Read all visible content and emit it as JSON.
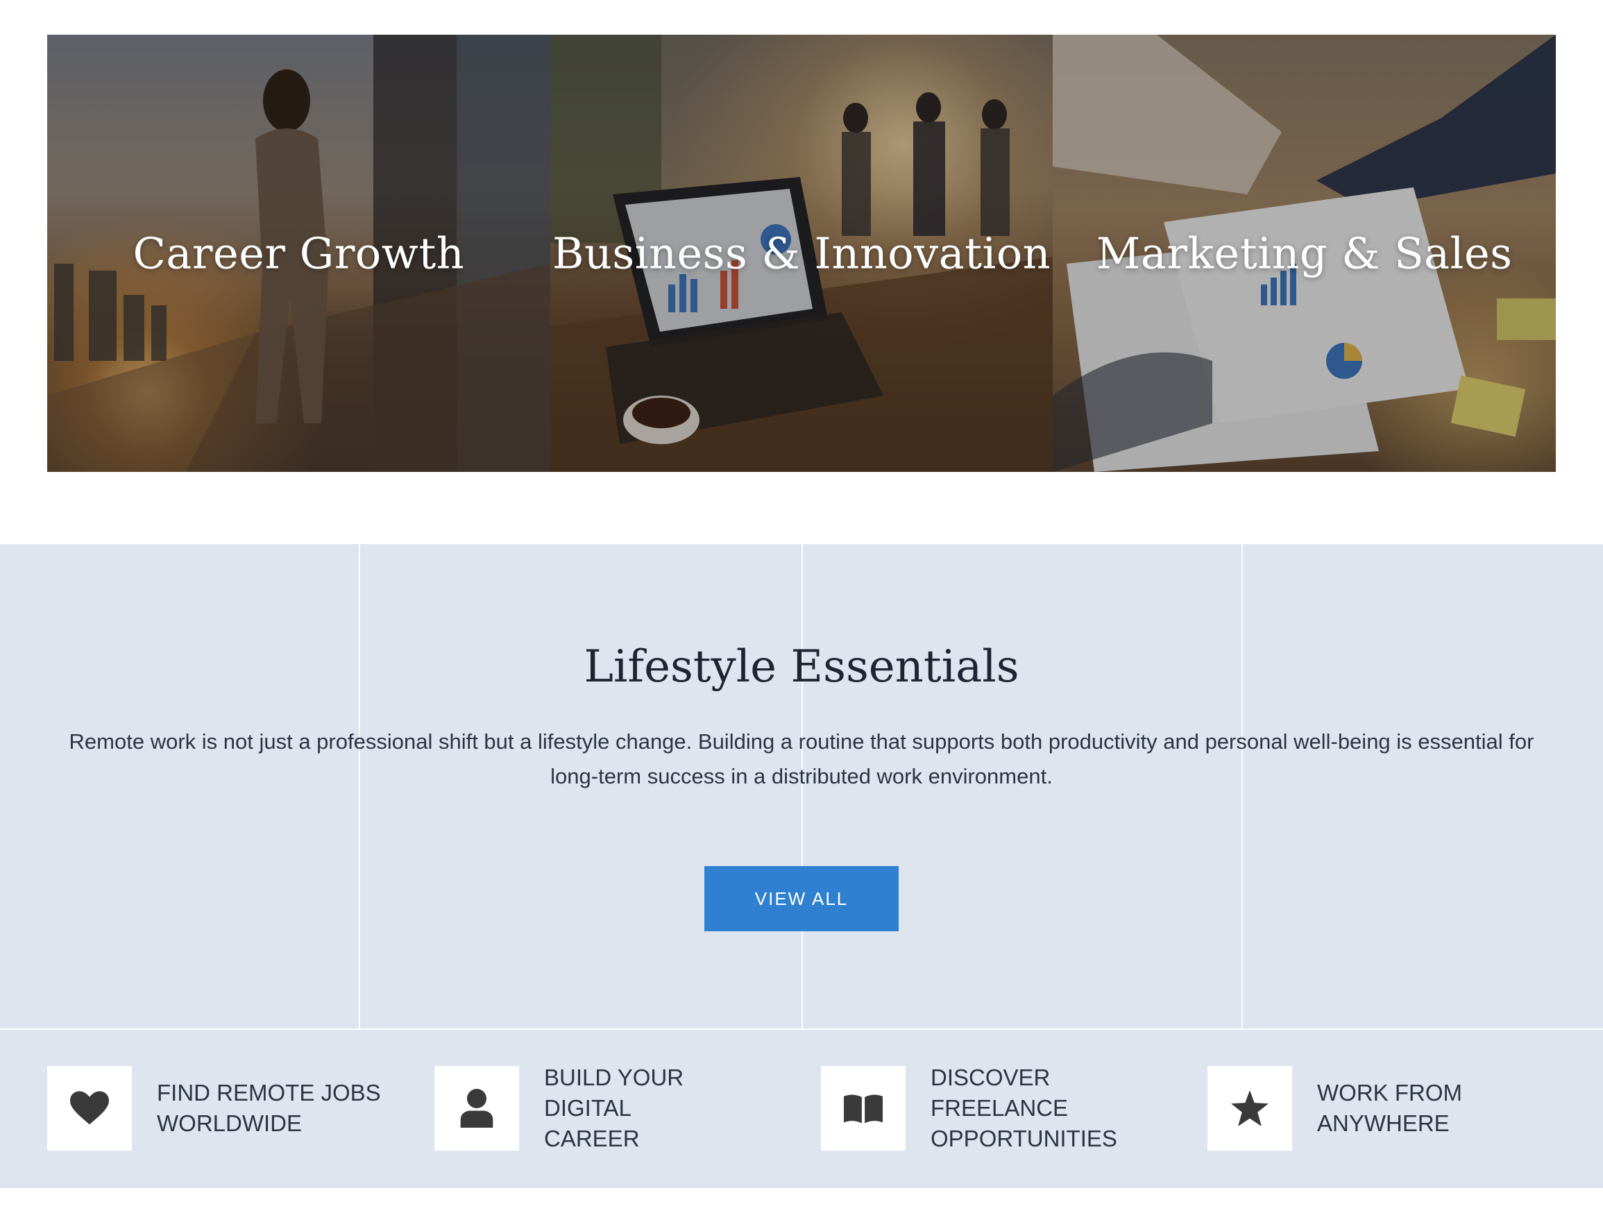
{
  "categories": [
    {
      "title": "Career Growth"
    },
    {
      "title": "Business & Innovation"
    },
    {
      "title": "Marketing & Sales"
    }
  ],
  "lifestyle": {
    "title": "Lifestyle Essentials",
    "text": "Remote work is not just a professional shift but a lifestyle change. Building a routine that supports both productivity and personal well-being is essential for long-term success in a distributed work environment.",
    "button_label": "VIEW ALL"
  },
  "features": [
    {
      "icon": "heart-icon",
      "line1": "FIND REMOTE JOBS",
      "line2": "WORLDWIDE"
    },
    {
      "icon": "user-icon",
      "line1": "BUILD YOUR DIGITAL",
      "line2": "CAREER"
    },
    {
      "icon": "book-icon",
      "line1": "DISCOVER FREELANCE",
      "line2": "OPPORTUNITIES"
    },
    {
      "icon": "star-icon",
      "line1": "WORK FROM",
      "line2": "ANYWHERE"
    }
  ],
  "colors": {
    "accent": "#2f80d0",
    "section_background": "#dee5ef",
    "text": "#2c3442",
    "icon": "#3a3a3a"
  }
}
